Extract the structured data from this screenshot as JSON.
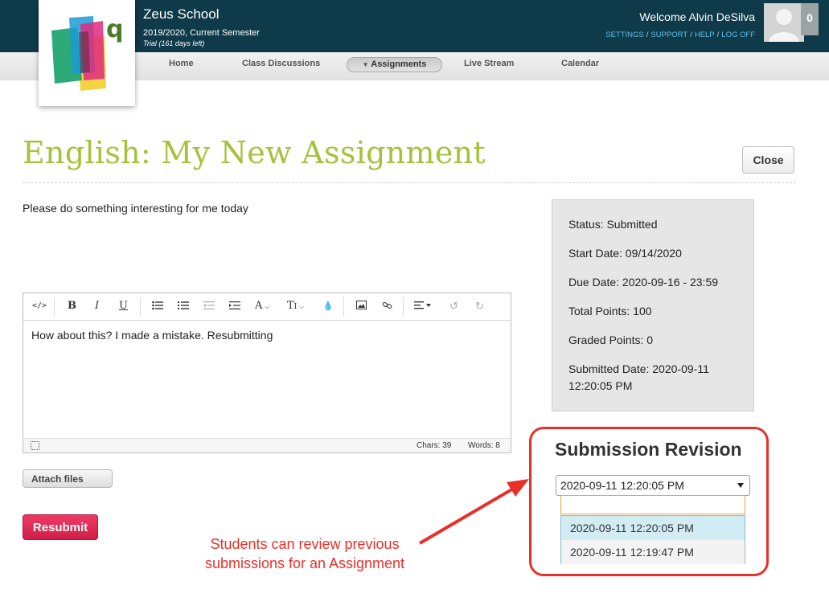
{
  "header": {
    "school_name": "Zeus School",
    "semester": "2019/2020, Current Semester",
    "trial": "Trial (161 days left)",
    "welcome": "Welcome Alvin DeSilva",
    "links": [
      "SETTINGS",
      "SUPPORT",
      "HELP",
      "LOG OFF"
    ],
    "notification_count": "0",
    "logo_letter": "q"
  },
  "nav": {
    "items": [
      "Home",
      "Class Discussions",
      "Assignments",
      "Live Stream",
      "Calendar"
    ],
    "active": "Assignments"
  },
  "assignment": {
    "title": "English: My New Assignment",
    "close_label": "Close",
    "instructions": "Please do something interesting for me today"
  },
  "editor": {
    "content": "How about this? I made a mistake. Resubmitting",
    "chars": "Chars: 39",
    "words": "Words: 8",
    "toolbar_icons": [
      "code-view",
      "bold",
      "italic",
      "underline",
      "bullet-list",
      "numbered-list",
      "outdent",
      "indent",
      "font-color",
      "text-size",
      "ink",
      "image",
      "link",
      "align",
      "undo",
      "redo"
    ]
  },
  "actions": {
    "attach_label": "Attach files",
    "resubmit_label": "Resubmit"
  },
  "status": {
    "status": "Status: Submitted",
    "start_date": "Start Date: 09/14/2020",
    "due_date": "Due Date: 2020-09-16 - 23:59",
    "total_points": "Total Points: 100",
    "graded_points": "Graded Points: 0",
    "submitted_date": "Submitted Date: 2020-09-11 12:20:05 PM"
  },
  "revision": {
    "title": "Submission Revision",
    "selected": "2020-09-11 12:20:05 PM",
    "options": [
      "2020-09-11 12:20:05 PM",
      "2020-09-11 12:19:47 PM"
    ]
  },
  "annotation": {
    "text": "Students can review previous submissions for an Assignment"
  },
  "colors": {
    "header_bg": "#0f3a4a",
    "title_green": "#a3c33b",
    "link_blue": "#5fc0e6",
    "resubmit_red": "#d11e48",
    "annotation_red": "#e8302a"
  }
}
